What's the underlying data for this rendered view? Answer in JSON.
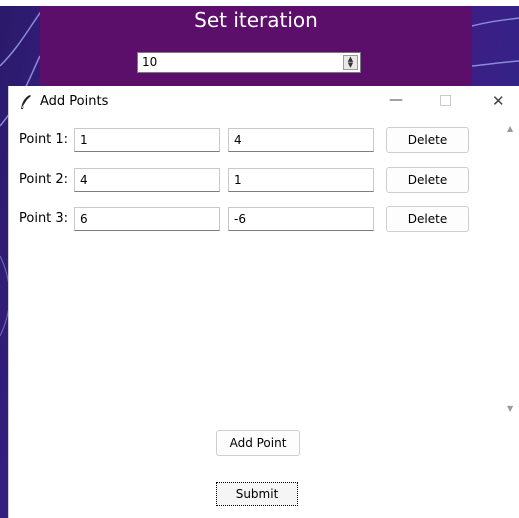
{
  "background_window": {
    "title": "Set iteration",
    "iteration_value": "10",
    "colors": {
      "panel": "#5b0f6a",
      "gradient": "#3a1f86"
    }
  },
  "dialog": {
    "title": "Add Points",
    "controls": {
      "minimize": "—",
      "maximize": "□",
      "close": "✕"
    },
    "points": [
      {
        "label": "Point 1:",
        "x": "1",
        "y": "4",
        "delete_label": "Delete"
      },
      {
        "label": "Point 2:",
        "x": "4",
        "y": "1",
        "delete_label": "Delete"
      },
      {
        "label": "Point 3:",
        "x": "6",
        "y": "-6",
        "delete_label": "Delete"
      }
    ],
    "add_point_label": "Add Point",
    "submit_label": "Submit",
    "icons": [
      "feather-icon",
      "scroll-up-icon",
      "scroll-down-icon"
    ]
  }
}
